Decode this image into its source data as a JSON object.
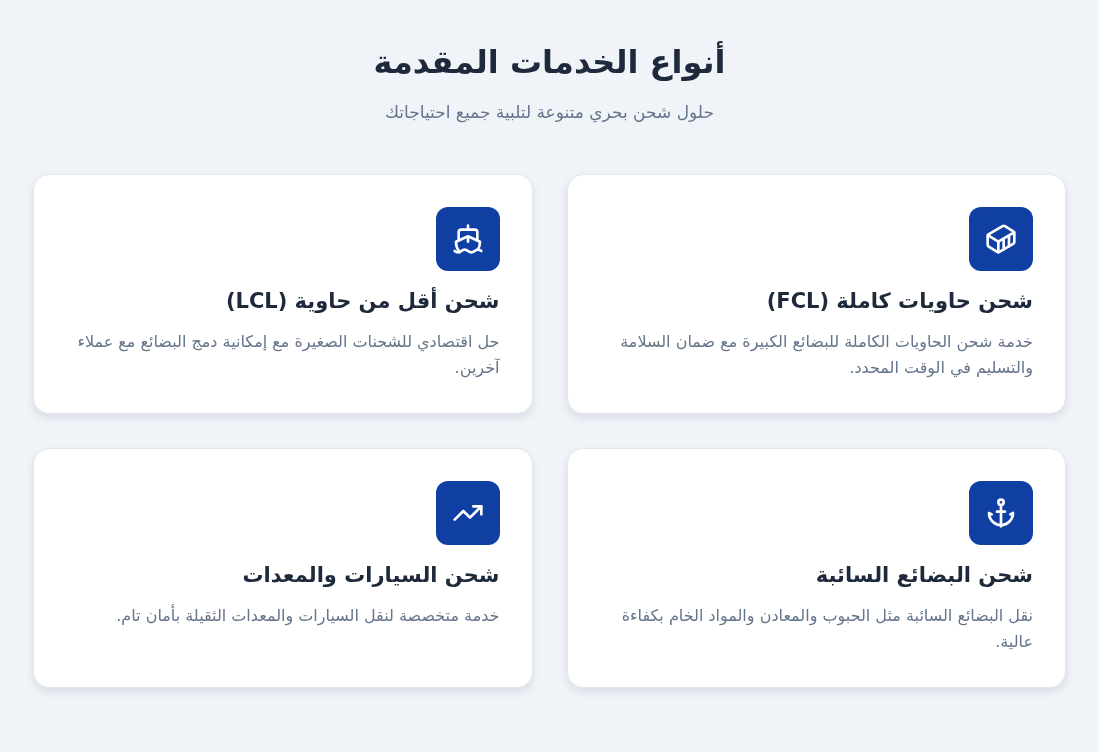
{
  "header": {
    "title": "أنواع الخدمات المقدمة",
    "subtitle": "حلول شحن بحري متنوعة لتلبية جميع احتياجاتك"
  },
  "services": [
    {
      "title": "شحن حاويات كاملة (FCL)",
      "description": "خدمة شحن الحاويات الكاملة للبضائع الكبيرة مع ضمان السلامة والتسليم في الوقت المحدد."
    },
    {
      "title": "شحن أقل من حاوية (LCL)",
      "description": "حل اقتصادي للشحنات الصغيرة مع إمكانية دمج البضائع مع عملاء آخرين."
    },
    {
      "title": "شحن البضائع السائبة",
      "description": "نقل البضائع السائبة مثل الحبوب والمعادن والمواد الخام بكفاءة عالية."
    },
    {
      "title": "شحن السيارات والمعدات",
      "description": "خدمة متخصصة لنقل السيارات والمعدات الثقيلة بأمان تام."
    }
  ]
}
